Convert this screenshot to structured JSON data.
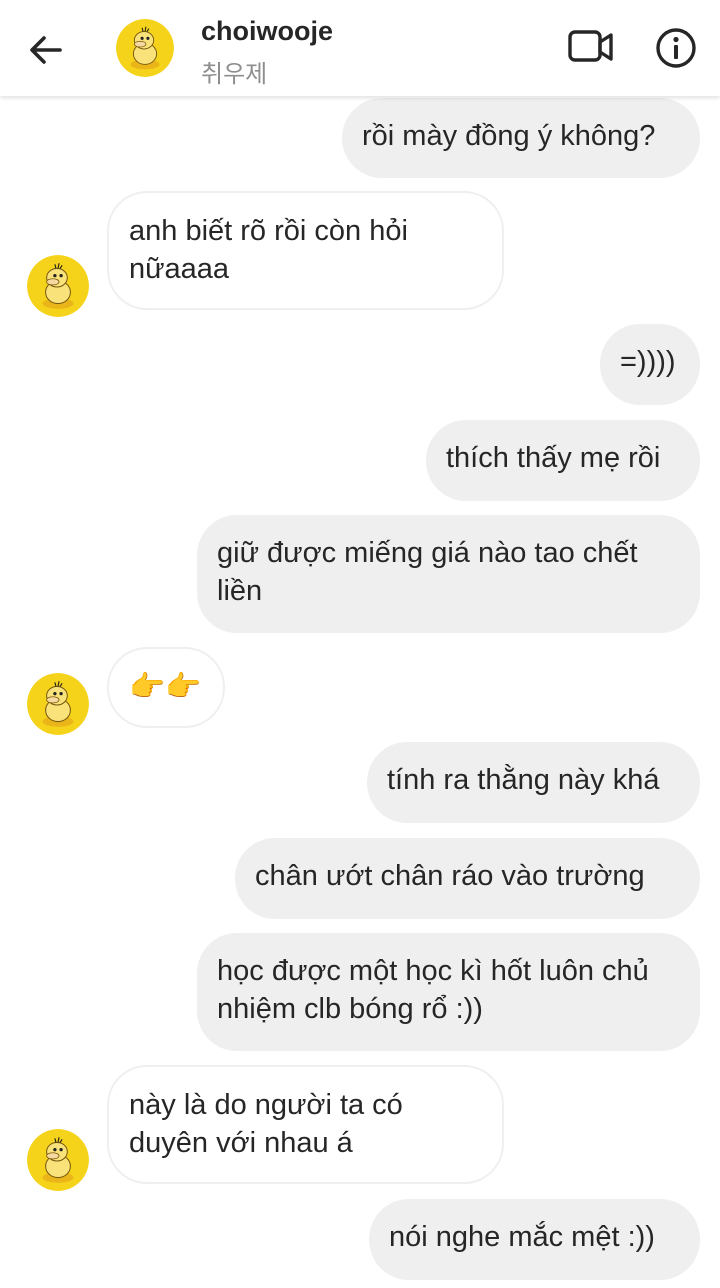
{
  "header": {
    "username": "choiwooje",
    "subtitle": "취우제",
    "back_icon": "arrow-left-icon",
    "video_icon": "video-camera-icon",
    "info_icon": "info-icon",
    "avatar": "psyduck-avatar"
  },
  "messages": [
    {
      "side": "out",
      "text": "rồi mày đồng ý không?"
    },
    {
      "side": "in",
      "text": "anh biết rõ rồi còn hỏi nữaaaa"
    },
    {
      "side": "out",
      "text": "=))))"
    },
    {
      "side": "out",
      "text": "thích thấy mẹ rồi"
    },
    {
      "side": "out",
      "text": "giữ được miếng giá nào tao chết liền"
    },
    {
      "side": "in",
      "text": "👉👉"
    },
    {
      "side": "out",
      "text": "tính ra thằng này khá"
    },
    {
      "side": "out",
      "text": "chân ướt chân ráo vào trường"
    },
    {
      "side": "out",
      "text": "học được một học kì hốt luôn chủ nhiệm clb bóng rổ :))"
    },
    {
      "side": "in",
      "text": "này là do người ta có duyên với nhau á"
    },
    {
      "side": "out",
      "text": "nói nghe mắc mệt :))"
    }
  ],
  "colors": {
    "outgoing_bubble": "#efefef",
    "incoming_border": "#efefef",
    "text": "#262626",
    "subtitle": "#8e8e8e",
    "avatar_yellow": "#f5d31b"
  }
}
